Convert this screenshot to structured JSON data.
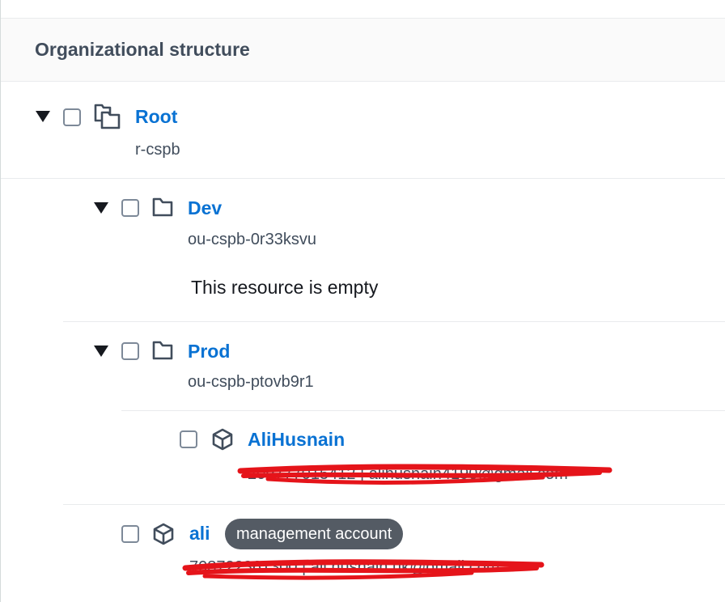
{
  "section": {
    "title": "Organizational structure"
  },
  "tree": {
    "root": {
      "name": "Root",
      "id": "r-cspb"
    },
    "dev": {
      "name": "Dev",
      "id": "ou-cspb-0r33ksvu",
      "empty_message": "This resource is empty"
    },
    "prod": {
      "name": "Prod",
      "id": "ou-cspb-ptovb9r1"
    },
    "account_alihusnain": {
      "name": "AliHusnain",
      "details": "209777015412 | alihusnain4190@gmail.com"
    },
    "account_ali": {
      "name": "ali",
      "badge": "management account",
      "details": "708722361300 | ali.husnain.uk@gmail.com"
    }
  },
  "icons": {
    "root": "root-folders-icon",
    "ou": "folder-icon",
    "account": "cube-icon",
    "expand": "caret-down-icon"
  },
  "colors": {
    "link": "#0972d3",
    "redaction": "#e5141a",
    "badge_bg": "#545b64"
  }
}
